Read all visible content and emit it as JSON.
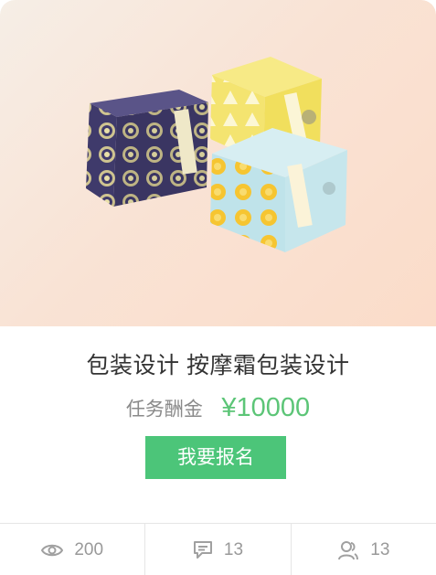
{
  "task": {
    "title": "包装设计 按摩霜包装设计",
    "reward_label": "任务酬金",
    "reward_value": "¥10000",
    "apply_button": "我要报名"
  },
  "stats": {
    "views": "200",
    "comments": "13",
    "participants": "13"
  },
  "colors": {
    "accent_green": "#4cc579",
    "price_green": "#5cc577",
    "hero_bg": "#f9e3d5"
  },
  "icons": {
    "views": "eye-icon",
    "comments": "comment-icon",
    "participants": "users-icon"
  }
}
